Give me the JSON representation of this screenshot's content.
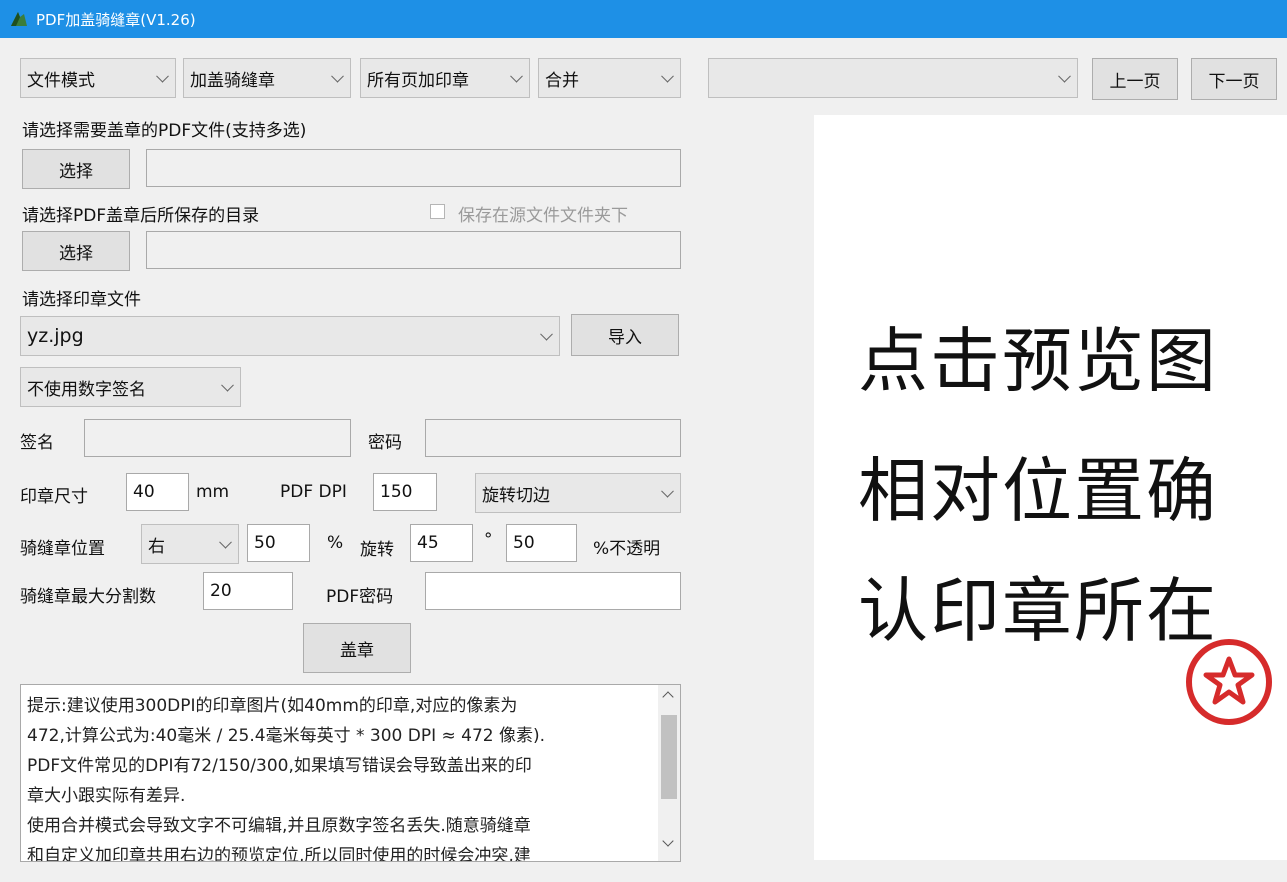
{
  "window": {
    "title": "PDF加盖骑缝章(V1.26)"
  },
  "toolbar": {
    "mode": "文件模式",
    "stamp_type": "加盖骑缝章",
    "page_scope": "所有页加印章",
    "merge": "合并",
    "page_select": "",
    "prev_page": "上一页",
    "next_page": "下一页"
  },
  "pdf_select": {
    "label": "请选择需要盖章的PDF文件(支持多选)",
    "button": "选择",
    "path": ""
  },
  "output_dir": {
    "label": "请选择PDF盖章后所保存的目录",
    "checkbox_label": "保存在源文件文件夹下",
    "checked": false,
    "button": "选择",
    "path": ""
  },
  "stamp_file": {
    "label": "请选择印章文件",
    "value": "yz.jpg",
    "import_button": "导入"
  },
  "signature": {
    "mode": "不使用数字签名",
    "sign_label": "签名",
    "sign_value": "",
    "password_label": "密码",
    "password_value": ""
  },
  "params": {
    "size_label": "印章尺寸",
    "size_value": "40",
    "size_unit": "mm",
    "dpi_label": "PDF DPI",
    "dpi_value": "150",
    "edge_mode": "旋转切边",
    "position_label": "骑缝章位置",
    "position_value": "右",
    "position_pct": "50",
    "pct_symbol": "%",
    "rotate_label": "旋转",
    "rotate_value": "45",
    "degree_symbol": "°",
    "opacity_value": "50",
    "opacity_label": "%不透明",
    "max_split_label": "骑缝章最大分割数",
    "max_split_value": "20",
    "pdf_password_label": "PDF密码",
    "pdf_password_value": ""
  },
  "actions": {
    "stamp_button": "盖章"
  },
  "tips": {
    "lines": [
      "提示:建议使用300DPI的印章图片(如40mm的印章,对应的像素为",
      "472,计算公式为:40毫米 / 25.4毫米每英寸 * 300 DPI ≈ 472 像素).",
      "PDF文件常见的DPI有72/150/300,如果填写错误会导致盖出来的印",
      "章大小跟实际有差异.",
      "使用合并模式会导致文字不可编辑,并且原数字签名丢失.随意骑缝章",
      "和自定义加印章共用右边的预览定位,所以同时使用的时候会冲突,建"
    ]
  },
  "preview": {
    "lines": [
      "点击预览图",
      "相对位置确",
      "认印章所在"
    ],
    "stamp_color": "#d62b2b"
  },
  "colors": {
    "titlebar": "#1e90e6",
    "window_bg": "#f0f0f0"
  }
}
